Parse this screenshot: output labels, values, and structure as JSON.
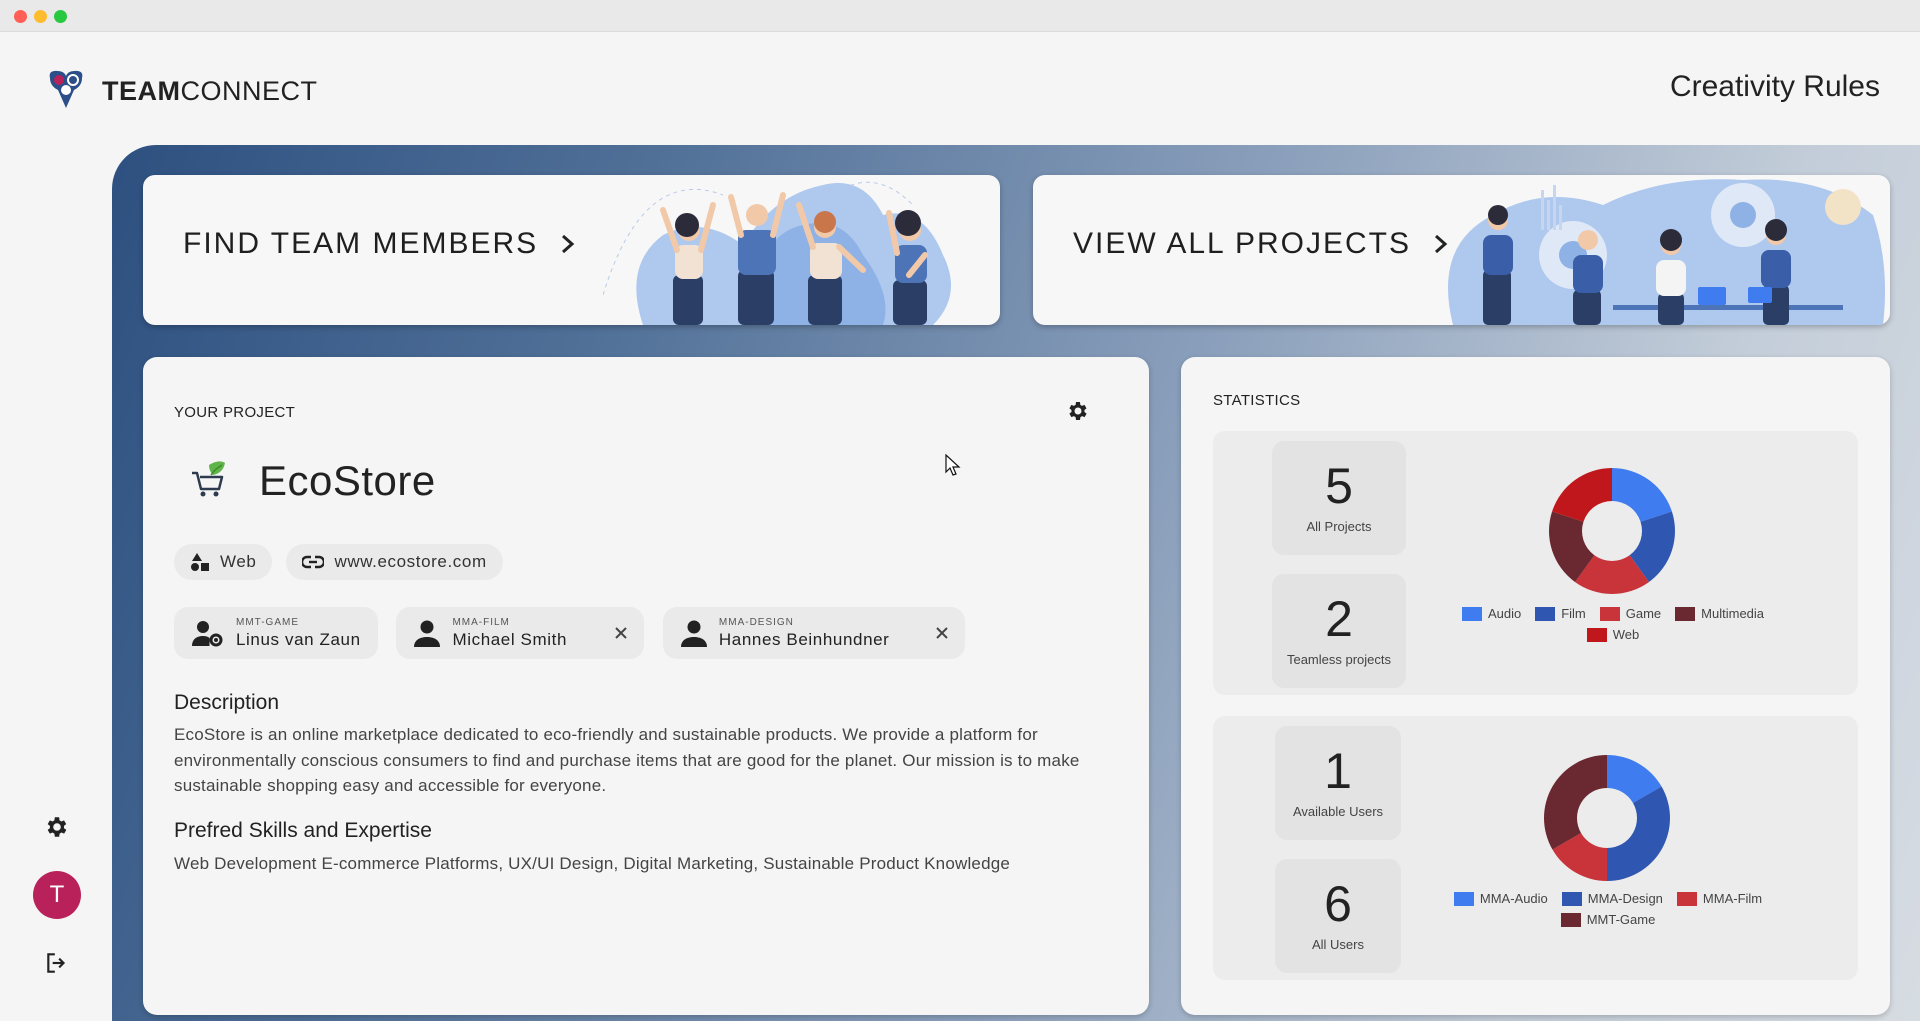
{
  "app": {
    "brand_bold": "TEAM",
    "brand_light": "CONNECT",
    "tagline": "Creativity Rules"
  },
  "sidebar": {
    "avatar_initial": "T",
    "icons": [
      "gear-icon",
      "logout-icon"
    ]
  },
  "banners": {
    "find_members": "FIND TEAM MEMBERS",
    "view_projects": "VIEW ALL PROJECTS"
  },
  "project": {
    "section_label": "YOUR PROJECT",
    "name": "EcoStore",
    "category": "Web",
    "website": "www.ecostore.com",
    "members": [
      {
        "group": "MMT-GAME",
        "name": "Linus van Zaun",
        "removable": false,
        "icon": "user-gear-icon"
      },
      {
        "group": "MMA-FILM",
        "name": "Michael Smith",
        "removable": true,
        "icon": "person-icon"
      },
      {
        "group": "MMA-DESIGN",
        "name": "Hannes Beinhundner",
        "removable": true,
        "icon": "person-icon"
      }
    ],
    "description_heading": "Description",
    "description": "EcoStore is an online marketplace dedicated to eco-friendly and sustainable products. We provide a platform for environmentally conscious consumers to find and purchase items that are good for the planet. Our mission is to make sustainable shopping easy and accessible for everyone.",
    "skills_heading": "Prefred Skills and Expertise",
    "skills": "Web Development E-commerce Platforms, UX/UI Design, Digital Marketing, Sustainable Product Knowledge"
  },
  "statistics": {
    "section_label": "STATISTICS",
    "projects": {
      "all_count": "5",
      "all_label": "All Projects",
      "teamless_count": "2",
      "teamless_label": "Teamless projects"
    },
    "users": {
      "available_count": "1",
      "available_label": "Available Users",
      "all_count": "6",
      "all_label": "All Users"
    }
  },
  "chart_data": [
    {
      "type": "pie",
      "title": "",
      "categories": [
        "Audio",
        "Film",
        "Game",
        "Multimedia",
        "Web"
      ],
      "values": [
        1,
        1,
        1,
        1,
        1
      ],
      "colors": [
        "#3f7cf0",
        "#2f56b0",
        "#c8343a",
        "#6a2830",
        "#c0171d"
      ],
      "legend": "bottom",
      "donut": true
    },
    {
      "type": "pie",
      "title": "",
      "categories": [
        "MMA-Audio",
        "MMA-Design",
        "MMA-Film",
        "MMT-Game"
      ],
      "values": [
        1,
        2,
        1,
        2
      ],
      "colors": [
        "#3f7cf0",
        "#2f56b0",
        "#c8343a",
        "#6a2830"
      ],
      "legend": "bottom",
      "donut": true
    }
  ]
}
